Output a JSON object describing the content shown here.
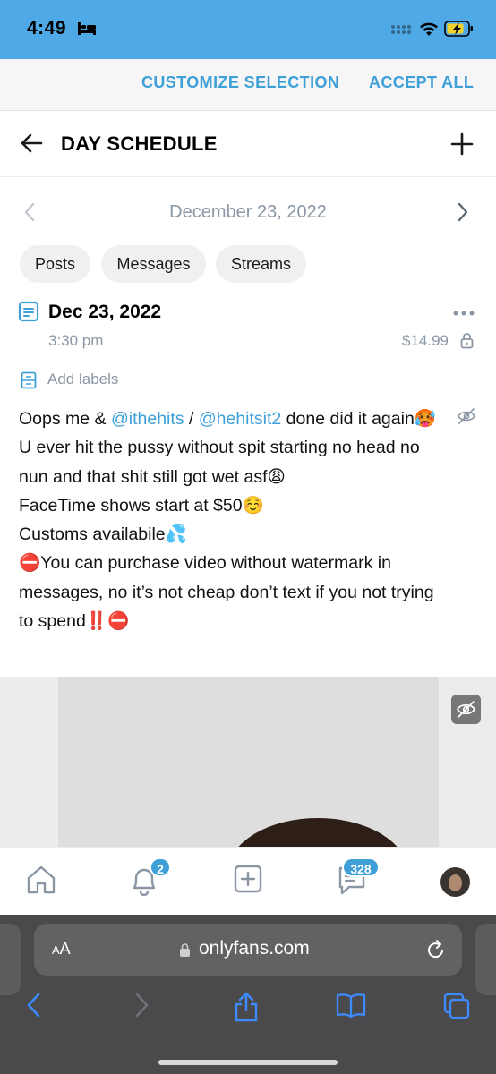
{
  "status_bar": {
    "time": "4:49"
  },
  "consent": {
    "customize_label": "CUSTOMIZE SELECTION",
    "accept_label": "ACCEPT ALL"
  },
  "header": {
    "title": "DAY SCHEDULE"
  },
  "date_nav": {
    "date": "December 23, 2022"
  },
  "filters": {
    "chips": [
      "Posts",
      "Messages",
      "Streams"
    ]
  },
  "post": {
    "date": "Dec 23, 2022",
    "time": "3:30 pm",
    "price": "$14.99",
    "add_labels": "Add labels",
    "text": {
      "l1_pre": "Oops me & ",
      "mention1": "@ithehits",
      "l1_mid": " / ",
      "mention2": "@hehitsit2",
      "l1_post": " done did it again🥵",
      "l2": "U ever hit the pussy without spit starting no head no nun and that shit still got wet asf😩",
      "l3": "FaceTime shows start at $50☺️",
      "l4": "Customs availabile💦",
      "l5": "⛔You can purchase video without watermark in messages, no it’s not cheap don’t text if you not trying to spend‼️⛔"
    }
  },
  "tabbar": {
    "notif_badge": "2",
    "msg_badge": "328"
  },
  "browser": {
    "aa_label_small": "A",
    "aa_label_big": "A",
    "url": "onlyfans.com"
  },
  "colors": {
    "accent": "#3fa0d8",
    "status_bar": "#4fa9e6",
    "muted": "#8a96a3",
    "browser": "#4a4a4c"
  }
}
